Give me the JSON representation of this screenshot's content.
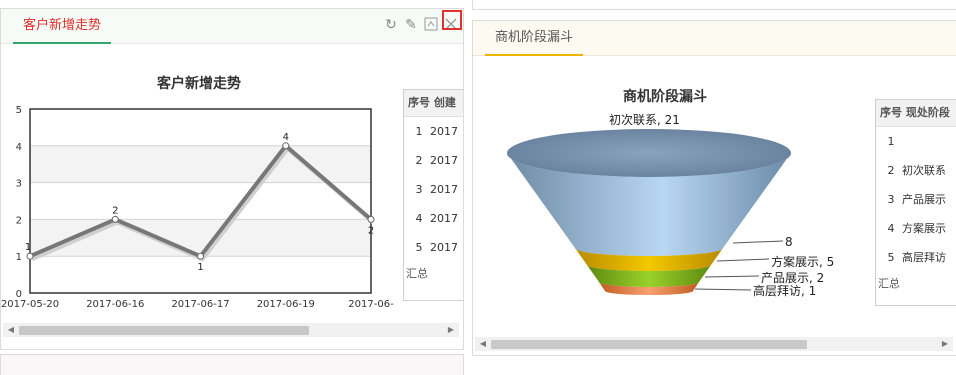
{
  "left_panel": {
    "tab_label": "客户新增走势",
    "chart_data": {
      "type": "line",
      "title": "客户新增走势",
      "categories": [
        "2017-05-20",
        "2017-06-16",
        "2017-06-17",
        "2017-06-19",
        "2017-06-"
      ],
      "values": [
        1,
        2,
        1,
        4,
        2
      ],
      "ylim": [
        0,
        5
      ],
      "yticks": [
        0,
        1,
        2,
        3,
        4,
        5
      ],
      "grid": true,
      "line_color": "#777777"
    },
    "table": {
      "headers": [
        "序号",
        "创建"
      ],
      "rows": [
        [
          "1",
          "2017"
        ],
        [
          "2",
          "2017"
        ],
        [
          "3",
          "2017"
        ],
        [
          "4",
          "2017"
        ],
        [
          "5",
          "2017"
        ]
      ],
      "footer": "汇总"
    }
  },
  "right_panel": {
    "tab_label": "商机阶段漏斗",
    "chart_data": {
      "type": "funnel",
      "title": "商机阶段漏斗",
      "stages": [
        {
          "name": "初次联系",
          "value": 21,
          "label": "初次联系, 21",
          "color": "#9bbcd9"
        },
        {
          "name": "方案展示",
          "value": 5,
          "label": "方案展示, 5",
          "color": "#e8b400"
        },
        {
          "name": "产品展示",
          "value": 2,
          "label": "产品展示, 2",
          "color": "#7db320"
        },
        {
          "name": "高层拜访",
          "value": 1,
          "label": "高层拜访, 1",
          "color": "#f08a50"
        }
      ],
      "extra_label": "8"
    },
    "table": {
      "headers": [
        "序号",
        "现处阶段"
      ],
      "rows": [
        [
          "1",
          ""
        ],
        [
          "2",
          "初次联系"
        ],
        [
          "3",
          "产品展示"
        ],
        [
          "4",
          "方案展示"
        ],
        [
          "5",
          "高层拜访"
        ]
      ],
      "footer": "汇总"
    }
  },
  "icons": {
    "refresh": "refresh-icon",
    "edit": "pencil-icon",
    "maximize": "maximize-icon",
    "close": "close-icon"
  },
  "colors": {
    "accent_red": "#e0302a",
    "tab_underline_green": "#2fa96c",
    "tab_underline_yellow": "#f0b400"
  }
}
